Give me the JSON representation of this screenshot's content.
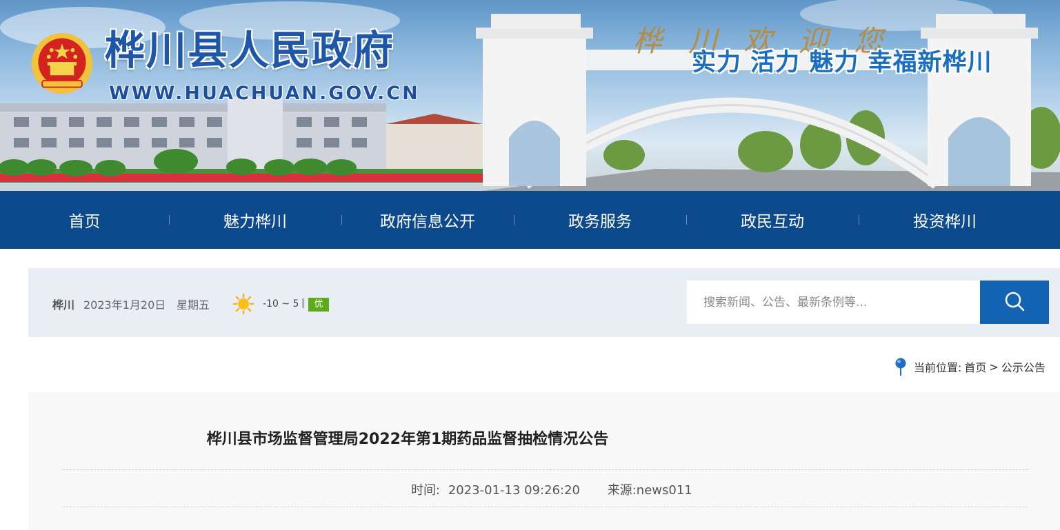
{
  "header": {
    "site_title": "桦川县人民政府",
    "site_url": "WWW.HUACHUAN.GOV.CN",
    "welcome_text": "桦川欢迎您",
    "slogan": "实力 活力 魅力 幸福新桦川"
  },
  "nav": {
    "items": [
      "首页",
      "魅力桦川",
      "政府信息公开",
      "政务服务",
      "政民互动",
      "投资桦川"
    ]
  },
  "infobar": {
    "location": "桦川",
    "date": "2023年1月20日",
    "weekday": "星期五",
    "temperature": "-10 ~ 5",
    "separator": "|",
    "air_quality": "优",
    "weather_icon": "sun-icon",
    "search_placeholder": "搜索新闻、公告、最新条例等...",
    "colors": {
      "nav_bg": "#0d4a8d",
      "search_btn": "#1363b4",
      "aqi_badge": "#5ea91c"
    }
  },
  "breadcrumb": {
    "label": "当前位置:",
    "home": "首页",
    "arrow": ">",
    "current": "公示公告"
  },
  "article": {
    "title": "桦川县市场监督管理局2022年第1期药品监督抽检情况公告",
    "time_label": "时间:",
    "time_value": "2023-01-13 09:26:20",
    "source_label": "来源:",
    "source_value": "news011"
  }
}
